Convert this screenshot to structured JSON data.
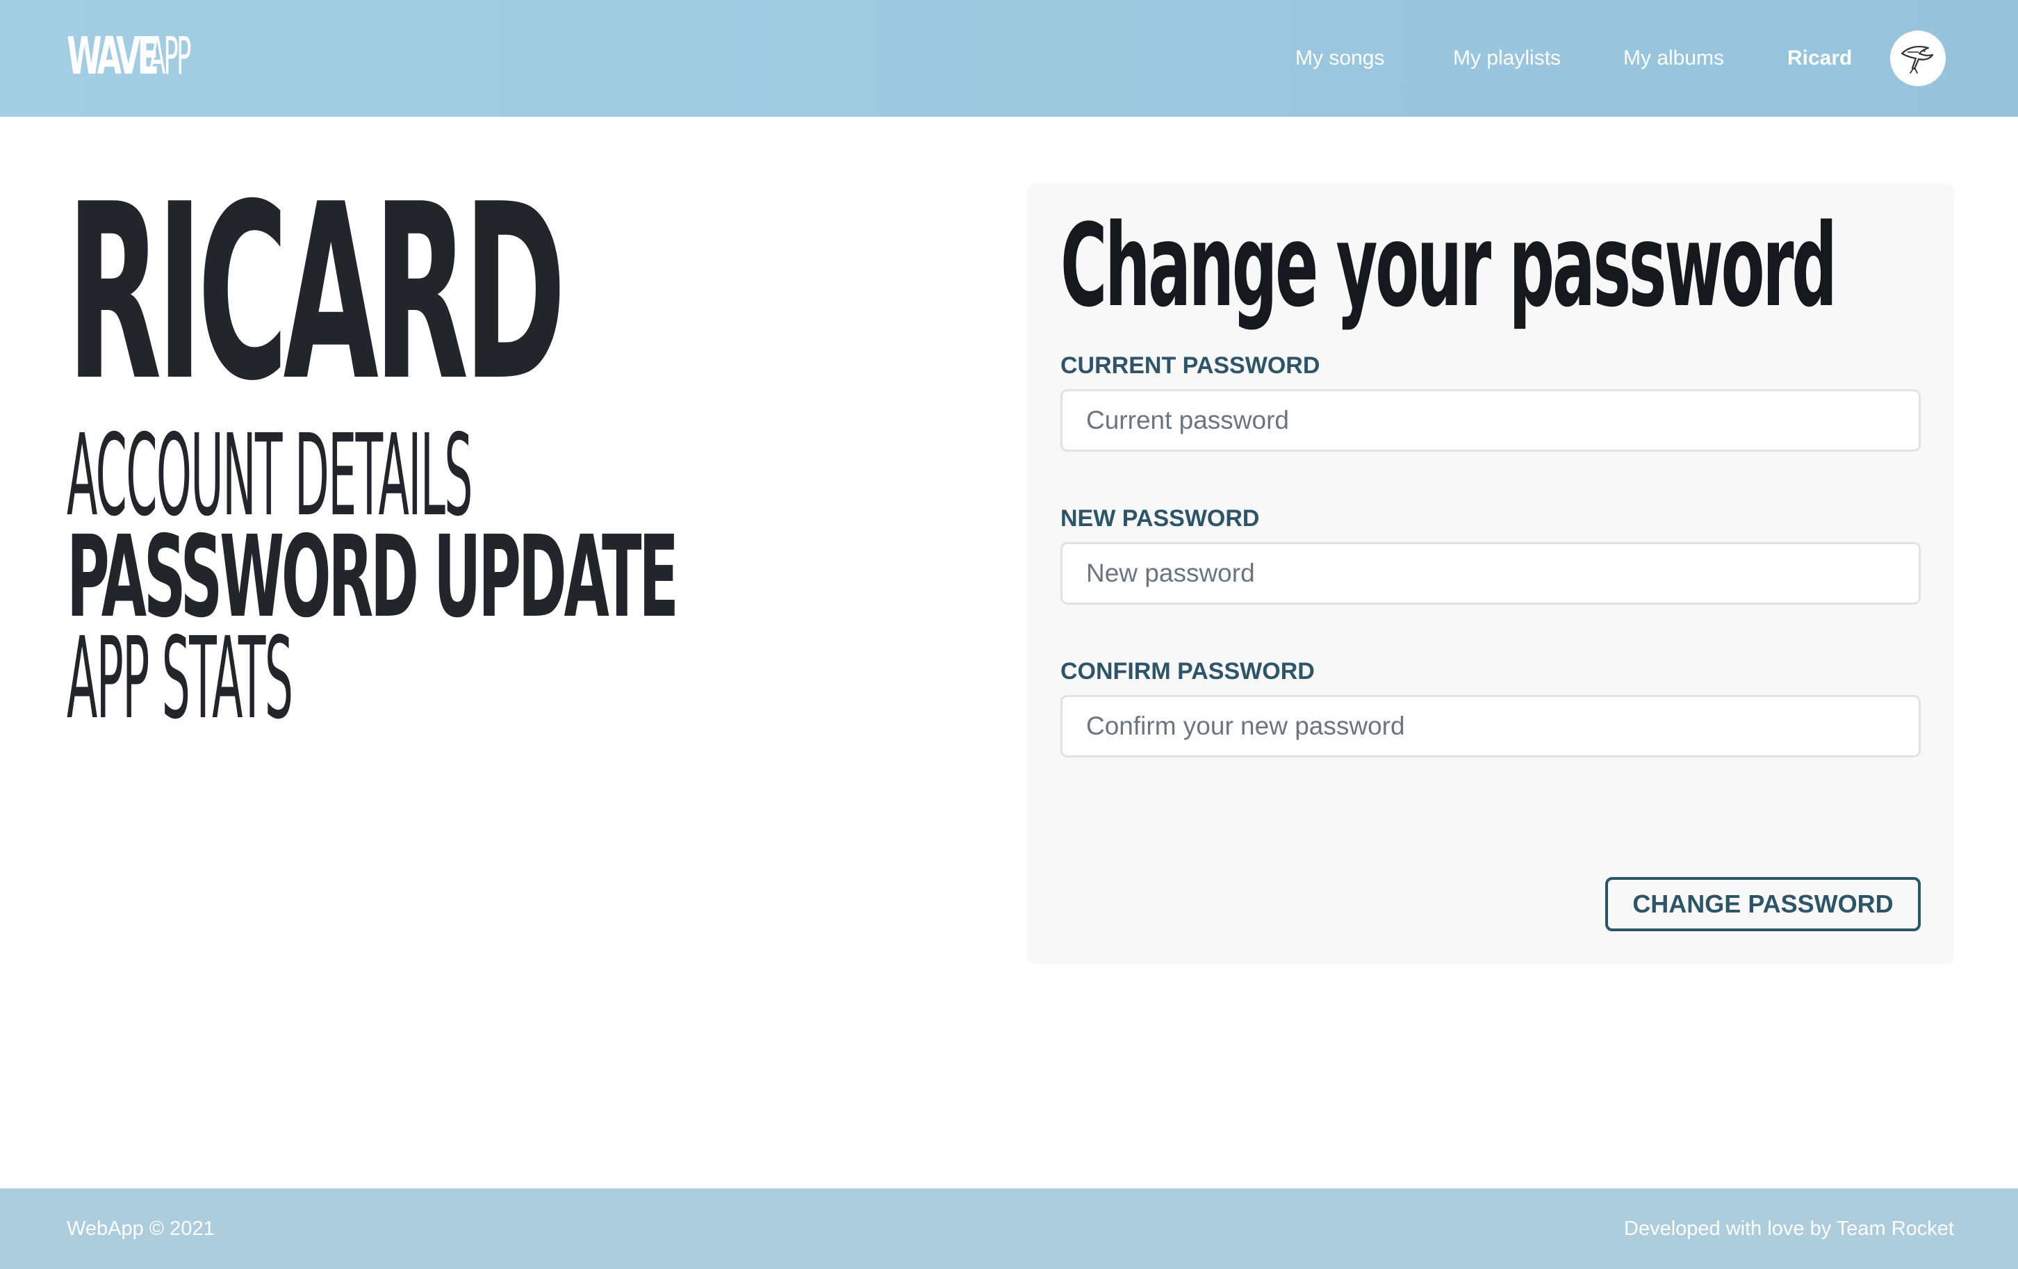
{
  "header": {
    "logo_strong": "WAVE",
    "logo_light": "APP",
    "nav": {
      "songs": "My songs",
      "playlists": "My playlists",
      "albums": "My albums",
      "user": "Ricard"
    },
    "avatar_icon": "bird-avatar-icon"
  },
  "sidebar": {
    "user_title": "RICARD",
    "items": [
      {
        "label": "ACCOUNT DETAILS",
        "active": false
      },
      {
        "label": "PASSWORD UPDATE",
        "active": true
      },
      {
        "label": "APP STATS",
        "active": false
      }
    ]
  },
  "form": {
    "title": "Change your password",
    "fields": [
      {
        "label": "CURRENT PASSWORD",
        "placeholder": "Current password",
        "value": ""
      },
      {
        "label": "NEW PASSWORD",
        "placeholder": "New password",
        "value": ""
      },
      {
        "label": "CONFIRM PASSWORD",
        "placeholder": "Confirm your new password",
        "value": ""
      }
    ],
    "submit_label": "CHANGE PASSWORD"
  },
  "footer": {
    "left": "WebApp © 2021",
    "right": "Developed with love by Team Rocket"
  },
  "colors": {
    "header_bg": "#a3cde2",
    "footer_bg": "#aecddc",
    "accent": "#2e5567",
    "card_bg": "#f8f8f8",
    "heading": "#22262b"
  }
}
